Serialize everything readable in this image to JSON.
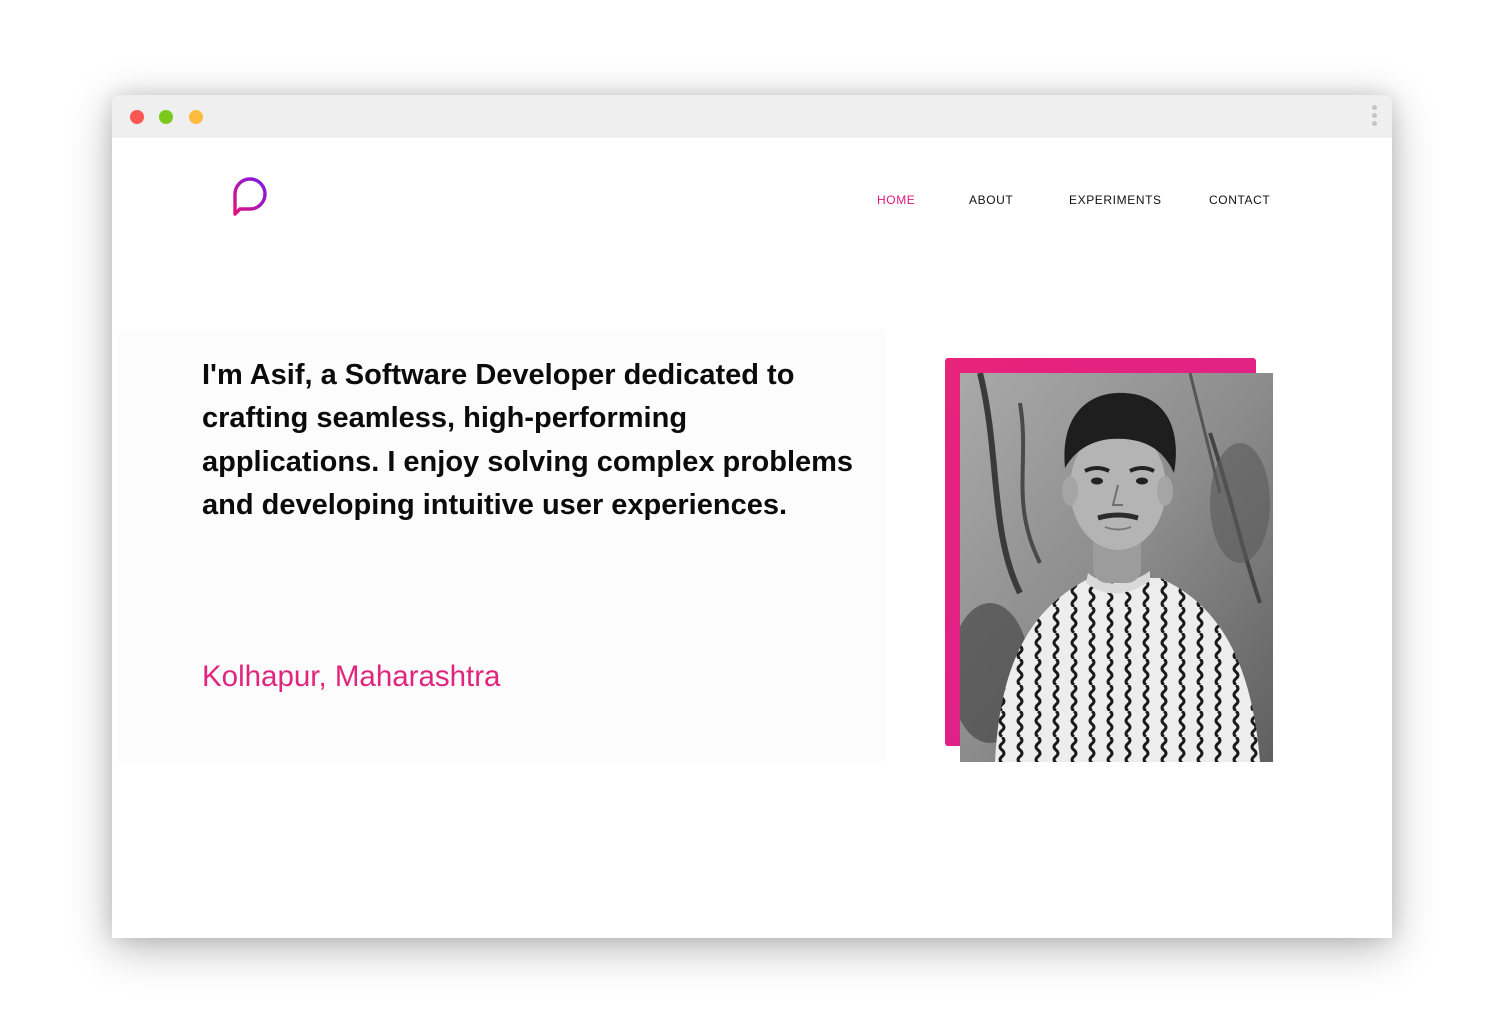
{
  "window": {
    "controls": [
      "close-dot",
      "minimize-dot",
      "maximize-dot"
    ],
    "control_colors": [
      "#fc5753",
      "#7cc91e",
      "#fdbc40"
    ],
    "menu_icon": "kebab-icon"
  },
  "header": {
    "logo_icon": "chat-bubble-logo-icon",
    "nav": {
      "home": "HOME",
      "about": "ABOUT",
      "experiments": "EXPERIMENTS",
      "contact": "CONTACT"
    },
    "active_item": "home"
  },
  "hero": {
    "intro": "I'm Asif, a Software Developer dedicated to crafting seamless, high-performing applications. I enjoy solving complex problems and developing intuitive user experiences.",
    "location": "Kolhapur, Maharashtra"
  },
  "colors": {
    "accent": "#e0197d",
    "gradient_start": "#e8237a",
    "gradient_end": "#a414b8",
    "text": "#0b0b0b"
  }
}
